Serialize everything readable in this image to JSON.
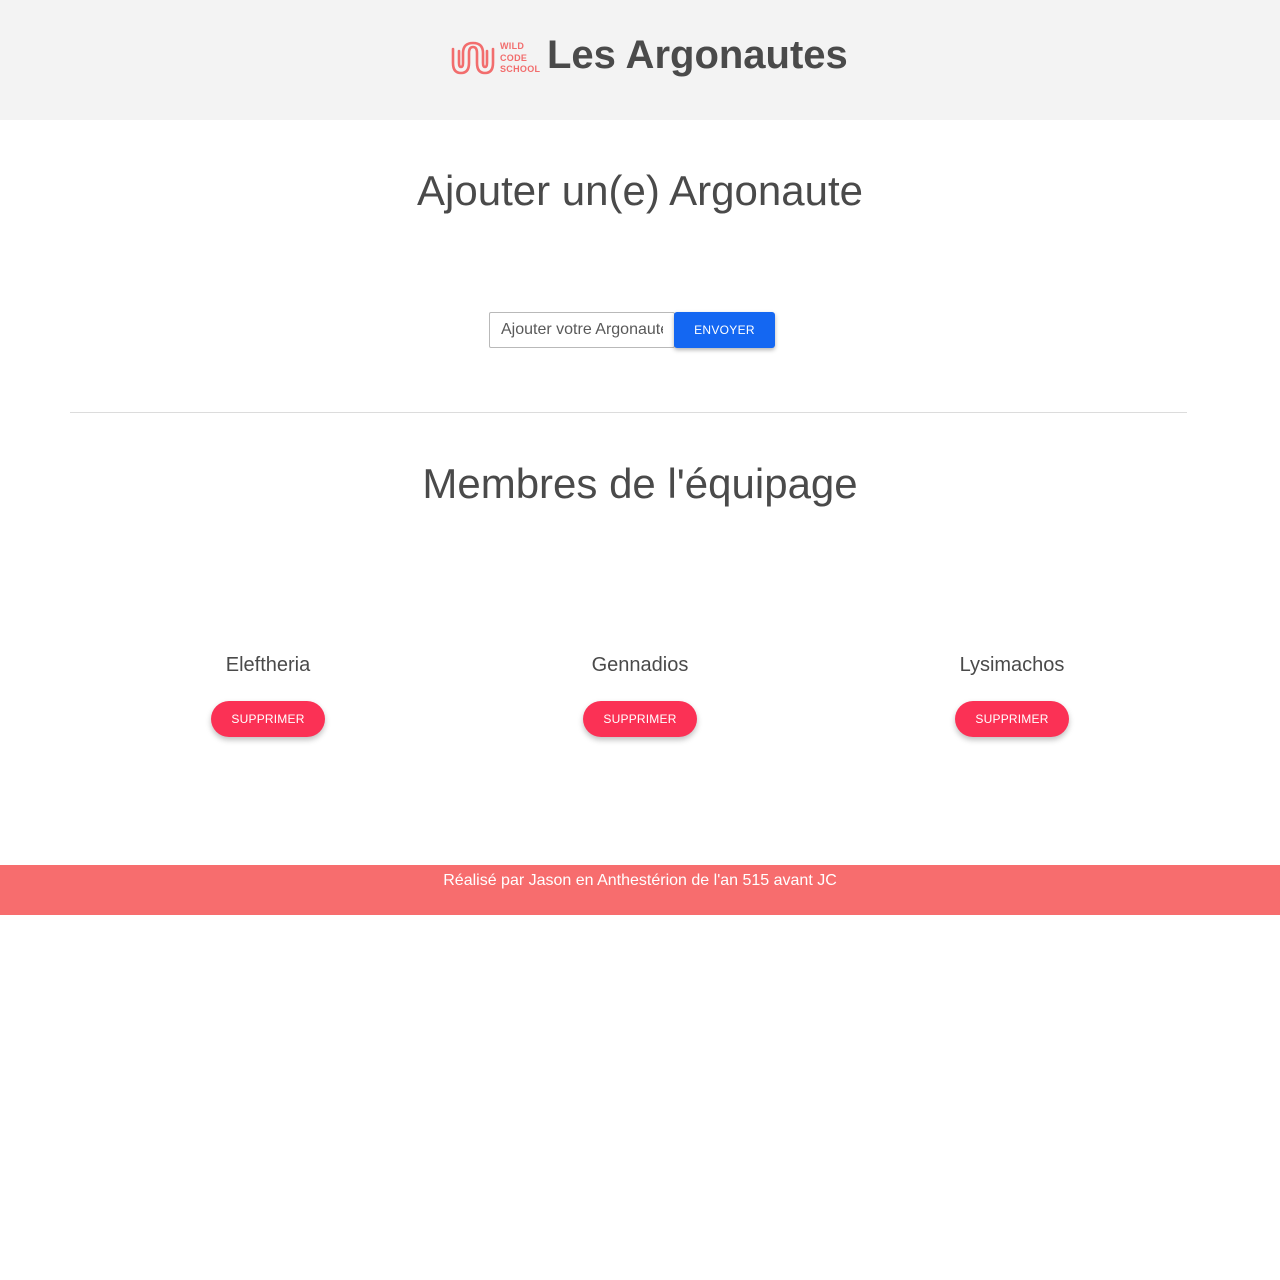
{
  "header": {
    "logo_lines": [
      "WILD",
      "CODE",
      "SCHOOL"
    ],
    "title": "Les Argonautes"
  },
  "add_section": {
    "heading": "Ajouter un(e) Argonaute",
    "input_placeholder": "Ajouter votre Argonaute",
    "input_value": "",
    "submit_label": "ENVOYER"
  },
  "crew_section": {
    "heading": "Membres de l'équipage",
    "members": [
      {
        "name": "Eleftheria",
        "delete_label": "SUPPRIMER"
      },
      {
        "name": "Gennadios",
        "delete_label": "SUPPRIMER"
      },
      {
        "name": "Lysimachos",
        "delete_label": "SUPPRIMER"
      }
    ]
  },
  "footer": {
    "text": "Réalisé par Jason en Anthestérion de l'an 515 avant JC"
  },
  "colors": {
    "header_bg": "#f3f3f3",
    "logo": "#f26d6d",
    "primary_button": "#1467f2",
    "delete_button": "#fb3155",
    "footer_bg": "#f76d6e",
    "text": "#4a4a4a"
  }
}
